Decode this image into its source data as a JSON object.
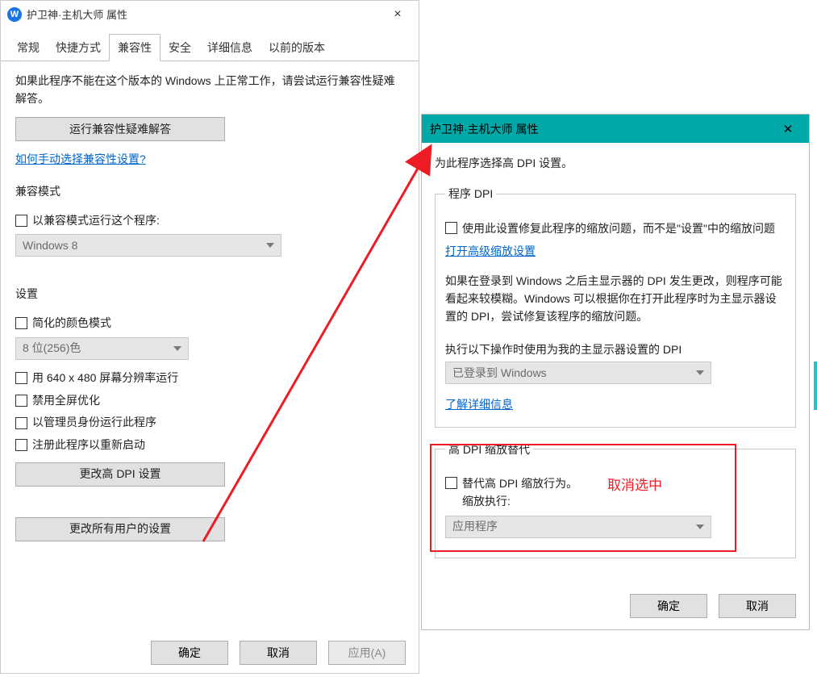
{
  "leftWindow": {
    "title": "护卫神·主机大师 属性",
    "closeGlyph": "×",
    "tabs": [
      "常规",
      "快捷方式",
      "兼容性",
      "安全",
      "详细信息",
      "以前的版本"
    ],
    "activeTabIndex": 2,
    "intro": "如果此程序不能在这个版本的 Windows 上正常工作，请尝试运行兼容性疑难解答。",
    "troubleshootBtn": "运行兼容性疑难解答",
    "manualLink": "如何手动选择兼容性设置?",
    "compatMode": {
      "legend": "兼容模式",
      "checkboxLabel": "以兼容模式运行这个程序:",
      "comboValue": "Windows 8"
    },
    "settings": {
      "legend": "设置",
      "reducedColorLabel": "简化的颜色模式",
      "colorCombo": "8 位(256)色",
      "lowResLabel": "用 640 x 480 屏幕分辨率运行",
      "disableFullscreenLabel": "禁用全屏优化",
      "runAsAdminLabel": "以管理员身份运行此程序",
      "registerRestartLabel": "注册此程序以重新启动",
      "dpiBtn": "更改高 DPI 设置"
    },
    "changeAllUsersBtn": "更改所有用户的设置",
    "footer": {
      "ok": "确定",
      "cancel": "取消",
      "apply": "应用(A)"
    }
  },
  "rightWindow": {
    "title": "护卫神·主机大师 属性",
    "closeGlyph": "✕",
    "header": "为此程序选择高 DPI 设置。",
    "programDpi": {
      "legend": "程序 DPI",
      "useFixLabel": "使用此设置修复此程序的缩放问题，而不是\"设置\"中的缩放问题",
      "advancedLink": "打开高级缩放设置",
      "explain": "如果在登录到 Windows 之后主显示器的 DPI 发生更改，则程序可能看起来较模糊。Windows 可以根据你在打开此程序时为主显示器设置的 DPI，尝试修复该程序的缩放问题。",
      "whenLabel": "执行以下操作时使用为我的主显示器设置的 DPI",
      "whenCombo": "已登录到 Windows",
      "learnMoreLink": "了解详细信息"
    },
    "override": {
      "legend": "高 DPI 缩放替代",
      "overrideLabel": "替代高 DPI 缩放行为。",
      "performedByLabel": "缩放执行:",
      "combo": "应用程序",
      "annotation": "取消选中"
    },
    "footer": {
      "ok": "确定",
      "cancel": "取消"
    }
  },
  "colors": {
    "accentTeal": "#00a8a8",
    "red": "#ee1c25",
    "link": "#0066cc"
  }
}
